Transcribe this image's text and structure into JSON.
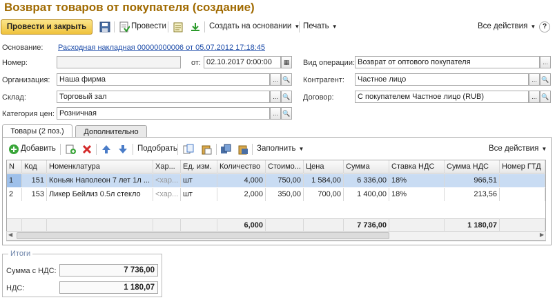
{
  "title": "Возврат товаров от покупателя (создание)",
  "toolbar": {
    "post_close": "Провести и закрыть",
    "post": "Провести",
    "create_based": "Создать на основании",
    "print": "Печать",
    "all_actions": "Все действия",
    "help": "?"
  },
  "form": {
    "basis_label": "Основание:",
    "basis_link": "Расходная накладная 00000000006 от 05.07.2012 17:18:45",
    "number_label": "Номер:",
    "number_value": "",
    "date_label": "от:",
    "date_value": "02.10.2017  0:00:00",
    "operation_label": "Вид операции:",
    "operation_value": "Возврат от оптового покупателя",
    "org_label": "Организация:",
    "org_value": "Наша фирма",
    "counterparty_label": "Контрагент:",
    "counterparty_value": "Частное лицо",
    "warehouse_label": "Склад:",
    "warehouse_value": "Торговый зал",
    "contract_label": "Договор:",
    "contract_value": "С покупателем Частное лицо (RUB)",
    "price_cat_label": "Категория цен:",
    "price_cat_value": "Розничная"
  },
  "tabs": [
    {
      "label": "Товары (2 поз.)"
    },
    {
      "label": "Дополнительно"
    }
  ],
  "table_toolbar": {
    "add": "Добавить",
    "pick": "Подобрать",
    "fill": "Заполнить",
    "all_actions": "Все действия"
  },
  "table": {
    "headers": [
      "N",
      "Код",
      "Номенклатура",
      "Хар...",
      "Ед. изм.",
      "Количество",
      "Стоимо...",
      "Цена",
      "Сумма",
      "Ставка НДС",
      "Сумма НДС",
      "Номер ГТД"
    ],
    "rows": [
      [
        "1",
        "151",
        "Коньяк Наполеон 7 лет 1л ...",
        "<хар...",
        "шт",
        "4,000",
        "750,00",
        "1 584,00",
        "6 336,00",
        "18%",
        "966,51",
        ""
      ],
      [
        "2",
        "153",
        "Ликер Бейлиз 0.5л стекло",
        "<хар...",
        "шт",
        "2,000",
        "350,00",
        "700,00",
        "1 400,00",
        "18%",
        "213,56",
        ""
      ]
    ],
    "footer": {
      "quantity": "6,000",
      "sum": "7 736,00",
      "vat_sum": "1 180,07"
    }
  },
  "totals": {
    "legend": "Итоги",
    "sum_label": "Сумма с НДС:",
    "sum_value": "7 736,00",
    "vat_label": "НДС:",
    "vat_value": "1 180,07"
  },
  "colors": {
    "title": "#a06a00",
    "primary_button": "#efc23c",
    "selection": "#c9dcf3",
    "link": "#1a4aa8"
  }
}
